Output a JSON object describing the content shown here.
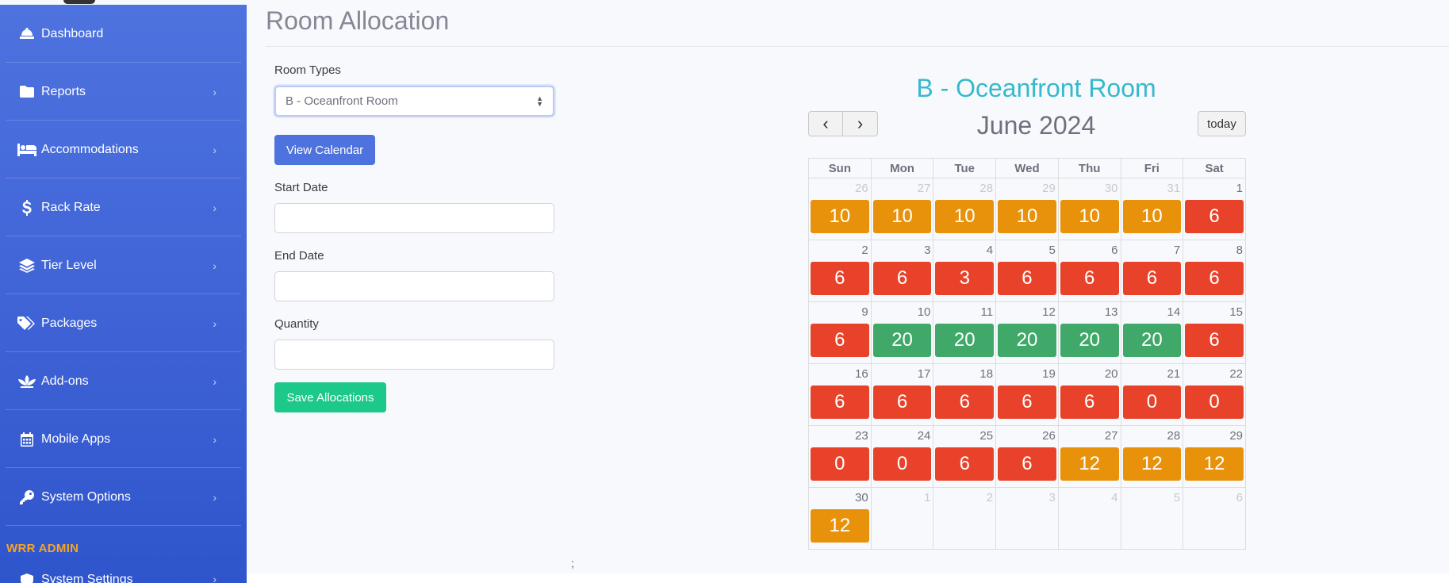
{
  "sidebar": {
    "items": [
      {
        "label": "Dashboard",
        "icon": "bell-icon",
        "chevron": false
      },
      {
        "label": "Reports",
        "icon": "folder-icon",
        "chevron": true
      },
      {
        "label": "Accommodations",
        "icon": "bed-icon",
        "chevron": true
      },
      {
        "label": "Rack Rate",
        "icon": "dollar-icon",
        "chevron": true
      },
      {
        "label": "Tier Level",
        "icon": "layers-icon",
        "chevron": true
      },
      {
        "label": "Packages",
        "icon": "tags-icon",
        "chevron": true
      },
      {
        "label": "Add-ons",
        "icon": "spa-icon",
        "chevron": true
      },
      {
        "label": "Mobile Apps",
        "icon": "calendar-icon",
        "chevron": true
      },
      {
        "label": "System Options",
        "icon": "key-icon",
        "chevron": true
      }
    ],
    "heading": "WRR ADMIN",
    "partial_item": {
      "label": "System Settings",
      "icon": "shield-icon"
    },
    "chevron_glyph": "›"
  },
  "main": {
    "title": "Room Allocation",
    "room_types_label": "Room Types",
    "room_types_value": "B - Oceanfront Room",
    "view_calendar_label": "View Calendar",
    "start_date_label": "Start Date",
    "end_date_label": "End Date",
    "quantity_label": "Quantity",
    "save_label": "Save Allocations",
    "stray_text": ";"
  },
  "calendar": {
    "room_title": "B - Oceanfront Room",
    "month_title": "June 2024",
    "prev_glyph": "‹",
    "next_glyph": "›",
    "today_label": "today",
    "weekdays": [
      "Sun",
      "Mon",
      "Tue",
      "Wed",
      "Thu",
      "Fri",
      "Sat"
    ],
    "colors": {
      "amber": "#e8920c",
      "red": "#e8432a",
      "green": "#40a96a"
    },
    "weeks": [
      [
        {
          "d": "26",
          "o": true,
          "v": "10",
          "c": "amber"
        },
        {
          "d": "27",
          "o": true,
          "v": "10",
          "c": "amber"
        },
        {
          "d": "28",
          "o": true,
          "v": "10",
          "c": "amber"
        },
        {
          "d": "29",
          "o": true,
          "v": "10",
          "c": "amber"
        },
        {
          "d": "30",
          "o": true,
          "v": "10",
          "c": "amber"
        },
        {
          "d": "31",
          "o": true,
          "v": "10",
          "c": "amber"
        },
        {
          "d": "1",
          "v": "6",
          "c": "red"
        }
      ],
      [
        {
          "d": "2",
          "v": "6",
          "c": "red"
        },
        {
          "d": "3",
          "v": "6",
          "c": "red"
        },
        {
          "d": "4",
          "v": "3",
          "c": "red"
        },
        {
          "d": "5",
          "v": "6",
          "c": "red"
        },
        {
          "d": "6",
          "v": "6",
          "c": "red"
        },
        {
          "d": "7",
          "v": "6",
          "c": "red"
        },
        {
          "d": "8",
          "v": "6",
          "c": "red"
        }
      ],
      [
        {
          "d": "9",
          "v": "6",
          "c": "red"
        },
        {
          "d": "10",
          "v": "20",
          "c": "green"
        },
        {
          "d": "11",
          "v": "20",
          "c": "green"
        },
        {
          "d": "12",
          "v": "20",
          "c": "green"
        },
        {
          "d": "13",
          "v": "20",
          "c": "green"
        },
        {
          "d": "14",
          "v": "20",
          "c": "green"
        },
        {
          "d": "15",
          "v": "6",
          "c": "red"
        }
      ],
      [
        {
          "d": "16",
          "v": "6",
          "c": "red"
        },
        {
          "d": "17",
          "v": "6",
          "c": "red"
        },
        {
          "d": "18",
          "v": "6",
          "c": "red"
        },
        {
          "d": "19",
          "v": "6",
          "c": "red"
        },
        {
          "d": "20",
          "v": "6",
          "c": "red"
        },
        {
          "d": "21",
          "v": "0",
          "c": "red"
        },
        {
          "d": "22",
          "v": "0",
          "c": "red"
        }
      ],
      [
        {
          "d": "23",
          "v": "0",
          "c": "red"
        },
        {
          "d": "24",
          "v": "0",
          "c": "red"
        },
        {
          "d": "25",
          "v": "6",
          "c": "red"
        },
        {
          "d": "26",
          "v": "6",
          "c": "red"
        },
        {
          "d": "27",
          "v": "12",
          "c": "amber"
        },
        {
          "d": "28",
          "v": "12",
          "c": "amber"
        },
        {
          "d": "29",
          "v": "12",
          "c": "amber"
        }
      ],
      [
        {
          "d": "30",
          "v": "12",
          "c": "amber"
        },
        {
          "d": "1",
          "o": true
        },
        {
          "d": "2",
          "o": true
        },
        {
          "d": "3",
          "o": true
        },
        {
          "d": "4",
          "o": true
        },
        {
          "d": "5",
          "o": true
        },
        {
          "d": "6",
          "o": true
        }
      ]
    ]
  }
}
